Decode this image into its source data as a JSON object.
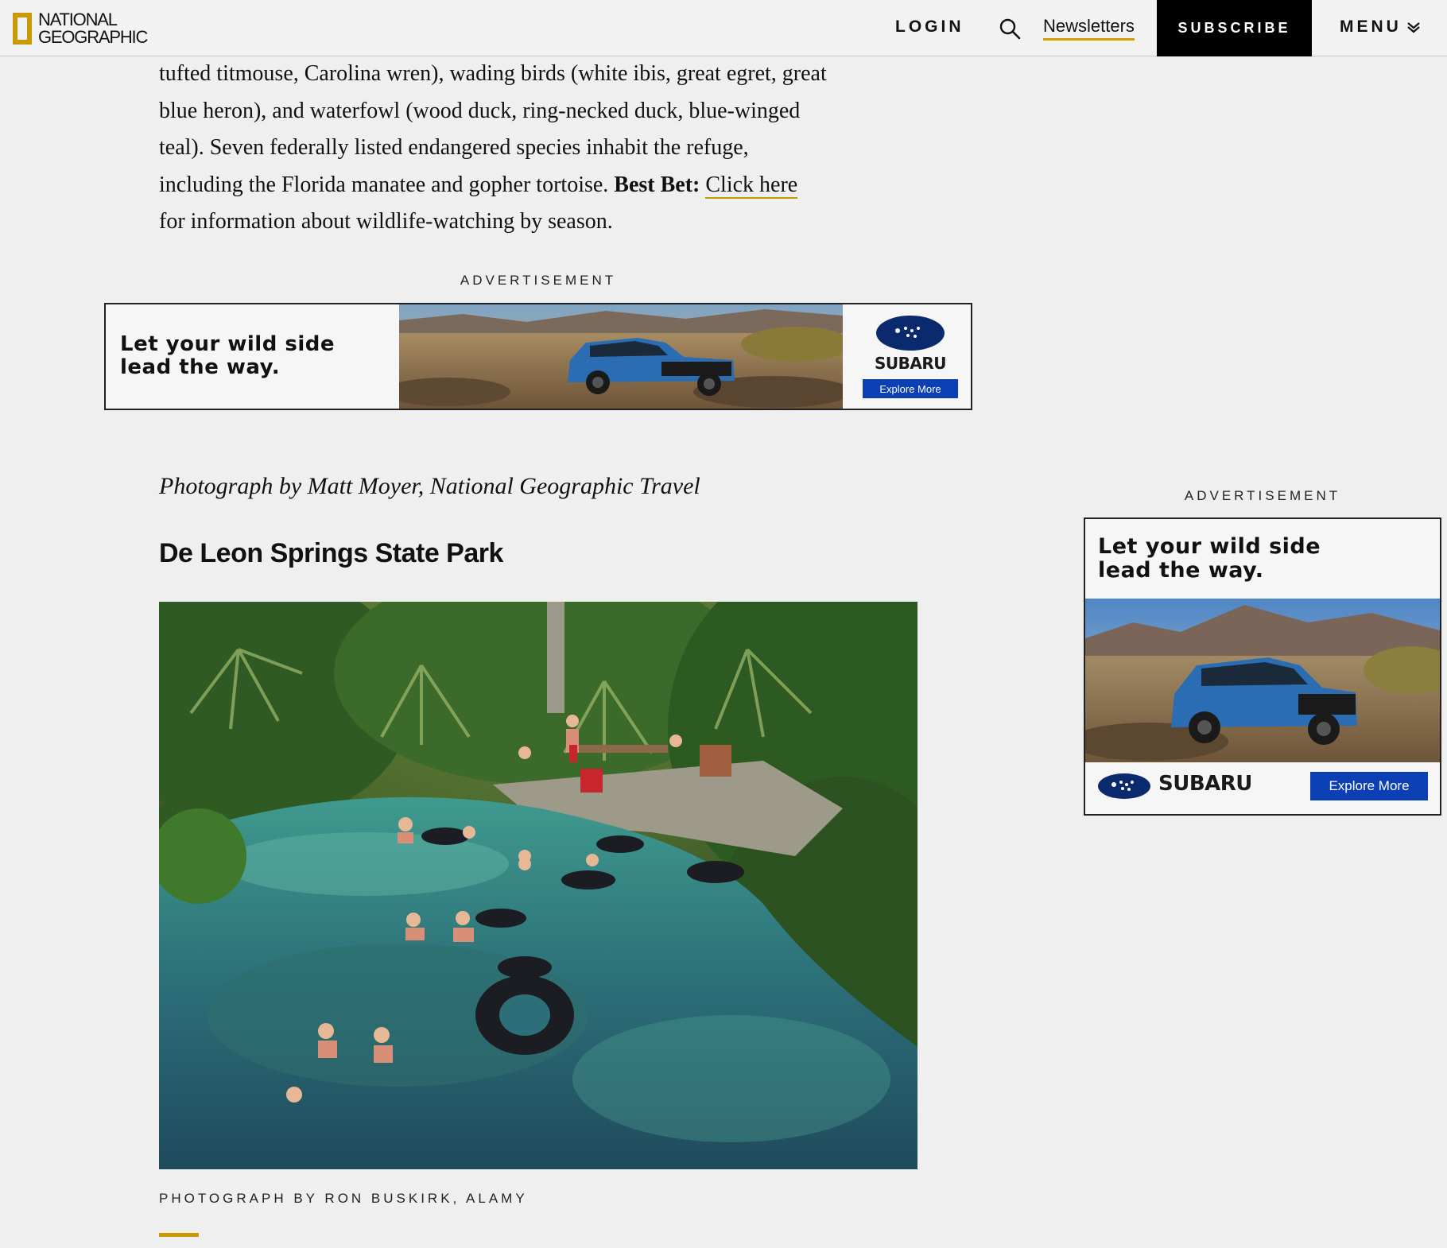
{
  "header": {
    "logo_line1": "National",
    "logo_line2": "Geographic",
    "login": "LOGIN",
    "newsletters": "Newsletters",
    "subscribe": "SUBSCRIBE",
    "menu": "MENU"
  },
  "article": {
    "para_lines": [
      "tufted titmouse, Carolina wren), wading birds (white ibis, great egret, great",
      "blue heron), and waterfowl (wood duck, ring-necked duck, blue-winged",
      "teal). Seven federally listed endangered species inhabit the refuge,",
      "including the Florida manatee and gopher tortoise. "
    ],
    "best_bet": "Best Bet:",
    "link_text": "Click here",
    "para_end": "for information about wildlife-watching by season.",
    "photo_credit_top": "Photograph by Matt Moyer, National Geographic Travel",
    "section_title": "De Leon Springs State Park",
    "caption": "Photograph by Ron Buskirk, Alamy"
  },
  "ads": {
    "label": "Advertisement",
    "tagline_line1": "Let your wild side",
    "tagline_line2": "lead the way.",
    "brand": "SUBARU",
    "cta": "Explore More"
  },
  "colors": {
    "gold": "#c99a00",
    "subscribe_bg": "#000000",
    "cta_blue": "#0b3fb3"
  }
}
